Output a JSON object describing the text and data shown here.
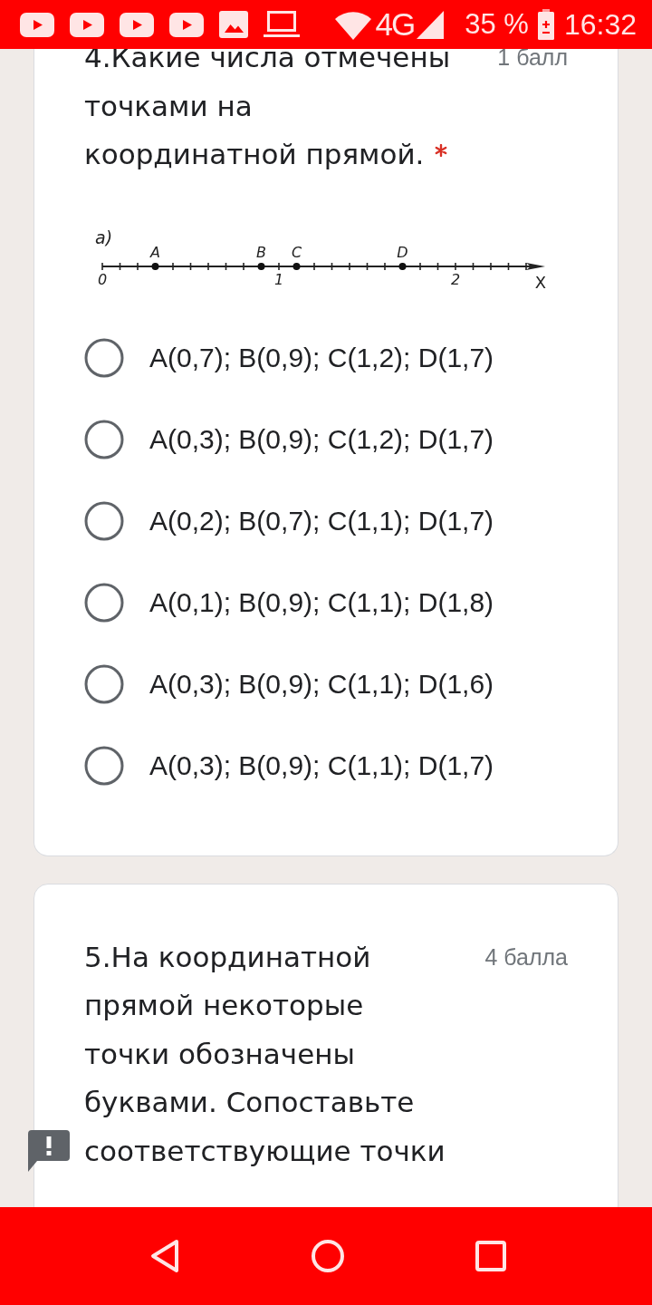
{
  "status_bar": {
    "network": "4G",
    "battery": "35 %",
    "time": "16:32"
  },
  "questions": [
    {
      "title": "4.Какие числа отмечены точками на координатной прямой.",
      "points": "1 балл",
      "required": true,
      "figure": {
        "part_label": "а)",
        "tick_labels": [
          "0",
          "1",
          "2"
        ],
        "axis_label": "X",
        "points": [
          {
            "label": "A"
          },
          {
            "label": "B"
          },
          {
            "label": "C"
          },
          {
            "label": "D"
          }
        ]
      },
      "options": [
        {
          "label": "A(0,7); B(0,9); C(1,2); D(1,7)",
          "selected": false
        },
        {
          "label": "A(0,3); B(0,9); C(1,2); D(1,7)",
          "selected": false
        },
        {
          "label": "A(0,2); B(0,7); C(1,1); D(1,7)",
          "selected": false
        },
        {
          "label": "A(0,1); B(0,9); C(1,1); D(1,8)",
          "selected": false
        },
        {
          "label": "A(0,3); B(0,9); C(1,1); D(1,6)",
          "selected": false
        },
        {
          "label": "A(0,3); B(0,9); C(1,1); D(1,7)",
          "selected": false
        }
      ]
    },
    {
      "title": "5.На координатной прямой некоторые точки обозначены буквами. Сопоставьте соответствующие точки",
      "points": "4 балла"
    }
  ]
}
